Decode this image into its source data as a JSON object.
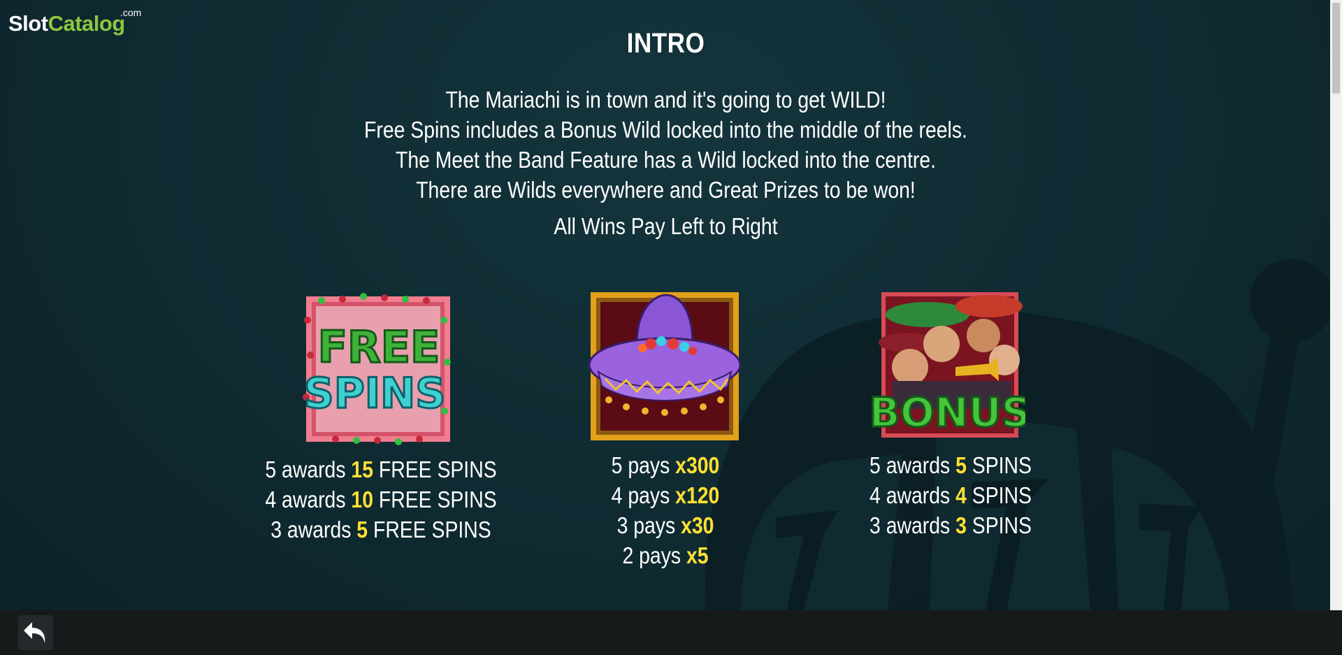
{
  "logo": {
    "slot": "Slot",
    "catalog": "Catalog",
    "dotcom": ".com"
  },
  "page": {
    "title": "INTRO",
    "intro_lines": [
      "The Mariachi is in town and it's going to get WILD!",
      "Free Spins includes a Bonus Wild locked into the middle of the reels.",
      "The Meet the Band Feature has a Wild locked into the centre.",
      "There are Wilds everywhere and Great Prizes to be won!"
    ],
    "paylines_note": "All Wins Pay Left to Right"
  },
  "symbols": {
    "free_spins": {
      "icon": "free-spins-symbol",
      "image_text": [
        "FREE",
        "SPINS"
      ],
      "rows": [
        {
          "prefix": "5 awards ",
          "value": "15",
          "suffix": " FREE SPINS"
        },
        {
          "prefix": "4 awards ",
          "value": "10",
          "suffix": " FREE SPINS"
        },
        {
          "prefix": "3 awards ",
          "value": "5",
          "suffix": " FREE SPINS"
        }
      ]
    },
    "sombrero": {
      "icon": "sombrero-symbol",
      "rows": [
        {
          "prefix": "5 pays ",
          "value": "x300",
          "suffix": ""
        },
        {
          "prefix": "4 pays ",
          "value": "x120",
          "suffix": ""
        },
        {
          "prefix": "3 pays ",
          "value": "x30",
          "suffix": ""
        },
        {
          "prefix": "2 pays ",
          "value": "x5",
          "suffix": ""
        }
      ]
    },
    "bonus": {
      "icon": "bonus-mariachi-symbol",
      "image_text": "BONUS",
      "rows": [
        {
          "prefix": "5 awards ",
          "value": "5",
          "suffix": " SPINS"
        },
        {
          "prefix": "4 awards ",
          "value": "4",
          "suffix": " SPINS"
        },
        {
          "prefix": "3 awards ",
          "value": "3",
          "suffix": " SPINS"
        }
      ]
    }
  },
  "controls": {
    "back_icon": "back-arrow-icon"
  },
  "colors": {
    "background": "#0e2a31",
    "highlight": "#ffe033",
    "logo_green": "#8cc63f",
    "bottom_bar": "#161a1b"
  }
}
